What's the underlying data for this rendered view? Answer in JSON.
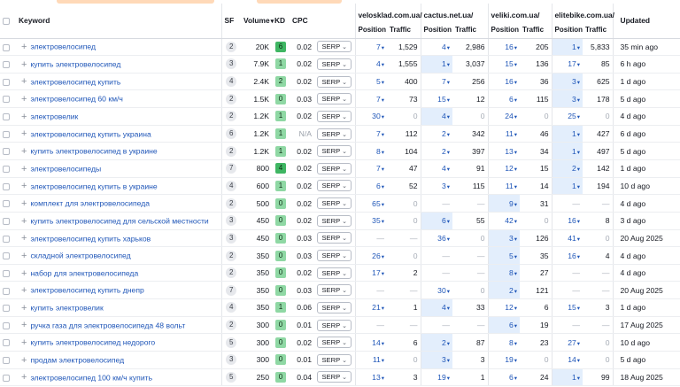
{
  "headers": {
    "keyword": "Keyword",
    "sf": "SF",
    "volume": "Volume",
    "volume_sort": "▾",
    "kd": "KD",
    "cpc": "CPC",
    "updated": "Updated",
    "position": "Position",
    "traffic": "Traffic"
  },
  "competitors": [
    "velosklad.com.ua/",
    "cactus.net.ua/",
    "veliki.com.ua/",
    "elitebike.com.ua/"
  ],
  "colors": {
    "kd_green_dark": "#3fb663",
    "kd_green_light": "#8fd8a4",
    "kd_gray": "#e6e8ec",
    "highlight": "#e3eefc",
    "link": "#1f56b8"
  },
  "serp_label": "SERP",
  "rows": [
    {
      "kw": "электровелосипед",
      "sf": "2",
      "vol": "20K",
      "kd": "6",
      "kdc": "#3fb663",
      "cpc": "0.02",
      "c": [
        [
          "7",
          "1,529"
        ],
        [
          "4",
          "2,986"
        ],
        [
          "16",
          "205"
        ],
        [
          "1",
          "5,833"
        ]
      ],
      "hi": [
        3
      ],
      "upd": "35 min ago"
    },
    {
      "kw": "купить электровелосипед",
      "sf": "3",
      "vol": "7.9K",
      "kd": "1",
      "kdc": "#8fd8a4",
      "cpc": "0.02",
      "c": [
        [
          "4",
          "1,555"
        ],
        [
          "1",
          "3,037"
        ],
        [
          "15",
          "136"
        ],
        [
          "17",
          "85"
        ]
      ],
      "hi": [
        1
      ],
      "upd": "6 h ago"
    },
    {
      "kw": "электровелосипед купить",
      "sf": "4",
      "vol": "2.4K",
      "kd": "2",
      "kdc": "#8fd8a4",
      "cpc": "0.02",
      "c": [
        [
          "5",
          "400"
        ],
        [
          "7",
          "256"
        ],
        [
          "16",
          "36"
        ],
        [
          "3",
          "625"
        ]
      ],
      "hi": [
        3
      ],
      "upd": "1 d ago"
    },
    {
      "kw": "электровелосипед 60 км/ч",
      "sf": "2",
      "vol": "1.5K",
      "kd": "0",
      "kdc": "#8fd8a4",
      "cpc": "0.03",
      "c": [
        [
          "7",
          "73"
        ],
        [
          "15",
          "12"
        ],
        [
          "6",
          "115"
        ],
        [
          "3",
          "178"
        ]
      ],
      "hi": [
        3
      ],
      "upd": "5 d ago"
    },
    {
      "kw": "электровелик",
      "sf": "2",
      "vol": "1.2K",
      "kd": "1",
      "kdc": "#8fd8a4",
      "cpc": "0.02",
      "c": [
        [
          "30",
          "0"
        ],
        [
          "4",
          "0"
        ],
        [
          "24",
          "0"
        ],
        [
          "25",
          "0"
        ]
      ],
      "hi": [
        1
      ],
      "upd": "4 d ago"
    },
    {
      "kw": "электровелосипед купить украина",
      "sf": "6",
      "vol": "1.2K",
      "kd": "1",
      "kdc": "#8fd8a4",
      "cpc": "N/A",
      "c": [
        [
          "7",
          "112"
        ],
        [
          "2",
          "342"
        ],
        [
          "11",
          "46"
        ],
        [
          "1",
          "427"
        ]
      ],
      "hi": [
        3
      ],
      "upd": "6 d ago"
    },
    {
      "kw": "купить электровелосипед в украине",
      "sf": "2",
      "vol": "1.2K",
      "kd": "1",
      "kdc": "#8fd8a4",
      "cpc": "0.02",
      "c": [
        [
          "8",
          "104"
        ],
        [
          "2",
          "397"
        ],
        [
          "13",
          "34"
        ],
        [
          "1",
          "497"
        ]
      ],
      "hi": [
        3
      ],
      "upd": "5 d ago"
    },
    {
      "kw": "электровелосипеды",
      "sf": "7",
      "vol": "800",
      "kd": "4",
      "kdc": "#3fb663",
      "cpc": "0.02",
      "c": [
        [
          "7",
          "47"
        ],
        [
          "4",
          "91"
        ],
        [
          "12",
          "15"
        ],
        [
          "2",
          "142"
        ]
      ],
      "hi": [
        3
      ],
      "upd": "1 d ago"
    },
    {
      "kw": "электровелосипед купить в украине",
      "sf": "4",
      "vol": "600",
      "kd": "1",
      "kdc": "#8fd8a4",
      "cpc": "0.02",
      "c": [
        [
          "6",
          "52"
        ],
        [
          "3",
          "115"
        ],
        [
          "11",
          "14"
        ],
        [
          "1",
          "194"
        ]
      ],
      "hi": [
        3
      ],
      "upd": "10 d ago"
    },
    {
      "kw": "комплект для электровелосипеда",
      "sf": "2",
      "vol": "500",
      "kd": "0",
      "kdc": "#8fd8a4",
      "cpc": "0.02",
      "c": [
        [
          "65",
          "0"
        ],
        [
          "",
          ""
        ],
        [
          "9",
          "31"
        ],
        [
          "",
          ""
        ]
      ],
      "hi": [
        2
      ],
      "upd": "4 d ago"
    },
    {
      "kw": "купить электровелосипед для сельской местности",
      "sf": "3",
      "vol": "450",
      "kd": "0",
      "kdc": "#8fd8a4",
      "cpc": "0.02",
      "c": [
        [
          "35",
          "0"
        ],
        [
          "6",
          "55"
        ],
        [
          "42",
          "0"
        ],
        [
          "16",
          "8"
        ]
      ],
      "hi": [
        1
      ],
      "upd": "3 d ago"
    },
    {
      "kw": "электровелосипед купить харьков",
      "sf": "3",
      "vol": "450",
      "kd": "0",
      "kdc": "#8fd8a4",
      "cpc": "0.03",
      "c": [
        [
          "",
          ""
        ],
        [
          "36",
          "0"
        ],
        [
          "3",
          "126"
        ],
        [
          "41",
          "0"
        ]
      ],
      "hi": [
        2
      ],
      "upd": "20 Aug 2025"
    },
    {
      "kw": "складной электровелосипед",
      "sf": "2",
      "vol": "350",
      "kd": "0",
      "kdc": "#8fd8a4",
      "cpc": "0.03",
      "c": [
        [
          "26",
          "0"
        ],
        [
          "",
          ""
        ],
        [
          "5",
          "35"
        ],
        [
          "16",
          "4"
        ]
      ],
      "hi": [
        2
      ],
      "upd": "4 d ago"
    },
    {
      "kw": "набор для электровелосипеда",
      "sf": "2",
      "vol": "350",
      "kd": "0",
      "kdc": "#8fd8a4",
      "cpc": "0.02",
      "c": [
        [
          "17",
          "2"
        ],
        [
          "",
          ""
        ],
        [
          "8",
          "27"
        ],
        [
          "",
          ""
        ]
      ],
      "hi": [
        2
      ],
      "upd": "4 d ago"
    },
    {
      "kw": "электровелосипед купить днепр",
      "sf": "7",
      "vol": "350",
      "kd": "0",
      "kdc": "#8fd8a4",
      "cpc": "0.03",
      "c": [
        [
          "",
          ""
        ],
        [
          "30",
          "0"
        ],
        [
          "2",
          "121"
        ],
        [
          "",
          ""
        ]
      ],
      "hi": [
        2
      ],
      "upd": "20 Aug 2025"
    },
    {
      "kw": "купить электровелик",
      "sf": "4",
      "vol": "350",
      "kd": "1",
      "kdc": "#8fd8a4",
      "cpc": "0.06",
      "c": [
        [
          "21",
          "1"
        ],
        [
          "4",
          "33"
        ],
        [
          "12",
          "6"
        ],
        [
          "15",
          "3"
        ]
      ],
      "hi": [
        1
      ],
      "upd": "1 d ago"
    },
    {
      "kw": "ручка газа для электровелосипеда 48 вольт",
      "sf": "2",
      "vol": "300",
      "kd": "0",
      "kdc": "#8fd8a4",
      "cpc": "0.01",
      "c": [
        [
          "",
          ""
        ],
        [
          "",
          ""
        ],
        [
          "6",
          "19"
        ],
        [
          "",
          ""
        ]
      ],
      "hi": [
        2
      ],
      "upd": "17 Aug 2025"
    },
    {
      "kw": "купить электровелосипед недорого",
      "sf": "5",
      "vol": "300",
      "kd": "0",
      "kdc": "#8fd8a4",
      "cpc": "0.02",
      "c": [
        [
          "14",
          "6"
        ],
        [
          "2",
          "87"
        ],
        [
          "8",
          "23"
        ],
        [
          "27",
          "0"
        ]
      ],
      "hi": [
        1
      ],
      "upd": "10 d ago"
    },
    {
      "kw": "продам электровелосипед",
      "sf": "3",
      "vol": "300",
      "kd": "0",
      "kdc": "#8fd8a4",
      "cpc": "0.01",
      "c": [
        [
          "11",
          "0"
        ],
        [
          "3",
          "3"
        ],
        [
          "19",
          "0"
        ],
        [
          "14",
          "0"
        ]
      ],
      "hi": [
        1
      ],
      "upd": "5 d ago"
    },
    {
      "kw": "электровелосипед 100 км/ч купить",
      "sf": "5",
      "vol": "250",
      "kd": "0",
      "kdc": "#8fd8a4",
      "cpc": "0.04",
      "c": [
        [
          "13",
          "3"
        ],
        [
          "19",
          "1"
        ],
        [
          "6",
          "24"
        ],
        [
          "1",
          "99"
        ]
      ],
      "hi": [
        3
      ],
      "upd": "18 Aug 2025"
    }
  ]
}
